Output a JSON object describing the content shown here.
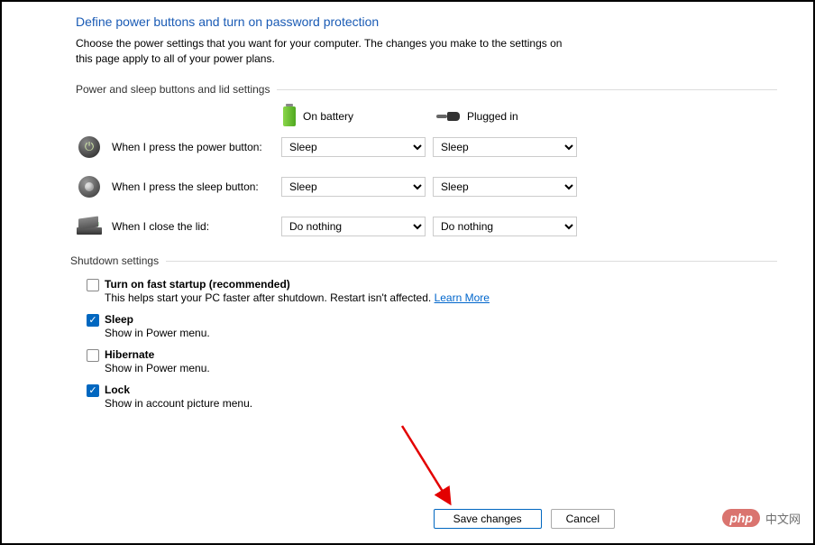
{
  "header": {
    "title": "Define power buttons and turn on password protection",
    "subtitle": "Choose the power settings that you want for your computer. The changes you make to the settings on this page apply to all of your power plans."
  },
  "powerSection": {
    "label": "Power and sleep buttons and lid settings",
    "columns": {
      "battery": "On battery",
      "plugged": "Plugged in"
    },
    "rows": {
      "power": {
        "label": "When I press the power button:",
        "battery": "Sleep",
        "plugged": "Sleep"
      },
      "sleep": {
        "label": "When I press the sleep button:",
        "battery": "Sleep",
        "plugged": "Sleep"
      },
      "lid": {
        "label": "When I close the lid:",
        "battery": "Do nothing",
        "plugged": "Do nothing"
      }
    }
  },
  "shutdownSection": {
    "label": "Shutdown settings",
    "fastStartup": {
      "label": "Turn on fast startup (recommended)",
      "desc": "This helps start your PC faster after shutdown. Restart isn't affected. ",
      "link": "Learn More"
    },
    "sleep": {
      "label": "Sleep",
      "desc": "Show in Power menu."
    },
    "hibernate": {
      "label": "Hibernate",
      "desc": "Show in Power menu."
    },
    "lock": {
      "label": "Lock",
      "desc": "Show in account picture menu."
    }
  },
  "buttons": {
    "save": "Save changes",
    "cancel": "Cancel"
  },
  "watermark": {
    "badge": "php",
    "text": "中文网"
  }
}
